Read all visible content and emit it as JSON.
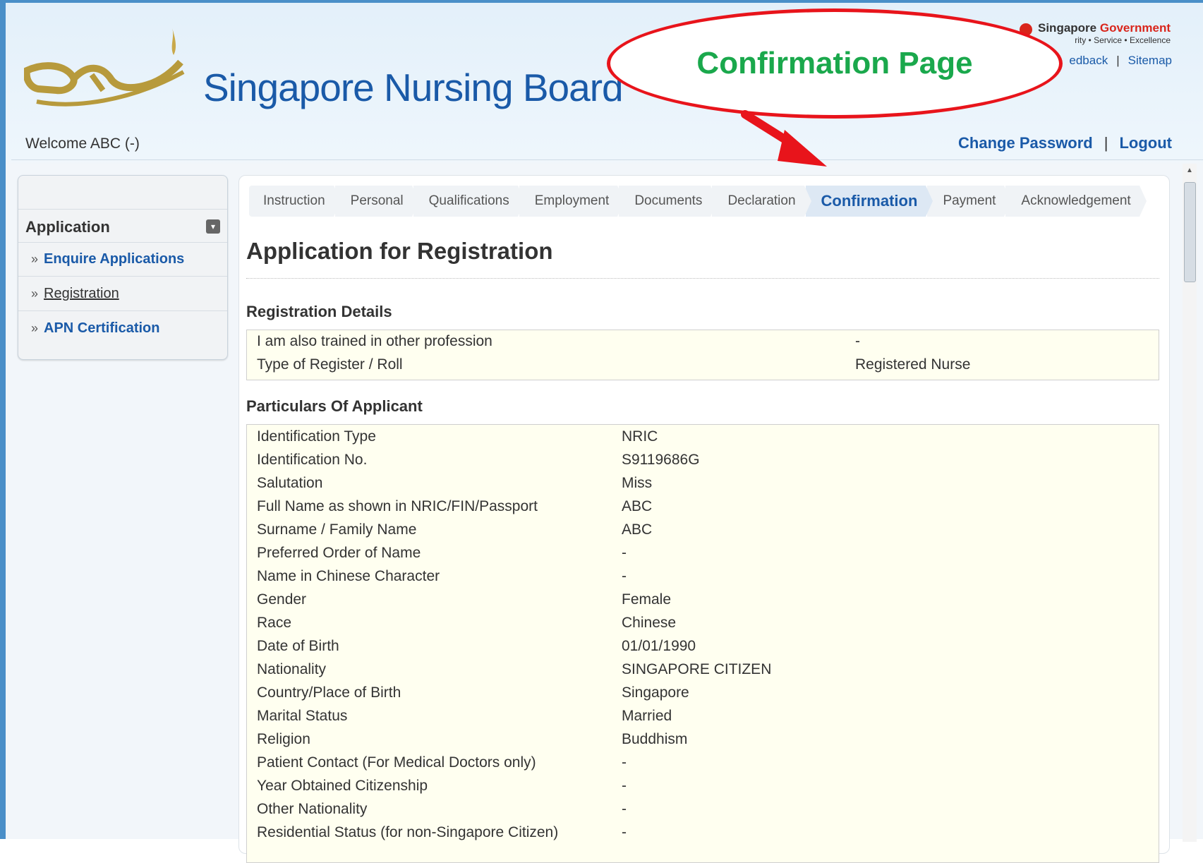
{
  "header": {
    "site_title": "Singapore Nursing Board",
    "gov_name_a": "Singapore",
    "gov_name_b": "Government",
    "gov_tagline": "rity • Service • Excellence",
    "toplinks": [
      "edback",
      "Sitemap"
    ],
    "welcome": "Welcome ABC (-)",
    "change_password": "Change Password",
    "logout": "Logout"
  },
  "annotation": {
    "callout": "Confirmation Page"
  },
  "sidebar": {
    "section": "Application",
    "items": [
      {
        "label": "Enquire Applications"
      },
      {
        "label": "Registration"
      },
      {
        "label": "APN Certification"
      }
    ],
    "bullet": "»"
  },
  "steps": [
    "Instruction",
    "Personal",
    "Qualifications",
    "Employment",
    "Documents",
    "Declaration",
    "Confirmation",
    "Payment",
    "Acknowledgement"
  ],
  "active_step": "Confirmation",
  "page_title": "Application for Registration",
  "registration_details": {
    "heading": "Registration Details",
    "rows": [
      {
        "label": "I am also trained in other profession",
        "value": "-"
      },
      {
        "label": "Type of Register / Roll",
        "value": "Registered Nurse"
      }
    ]
  },
  "particulars": {
    "heading": "Particulars Of Applicant",
    "rows": [
      {
        "label": "Identification Type",
        "value": "NRIC"
      },
      {
        "label": "Identification No.",
        "value": "S9119686G"
      },
      {
        "label": "Salutation",
        "value": "Miss"
      },
      {
        "label": "Full Name as shown in NRIC/FIN/Passport",
        "value": "ABC"
      },
      {
        "label": "Surname / Family Name",
        "value": "ABC"
      },
      {
        "label": "Preferred Order of Name",
        "value": "-"
      },
      {
        "label": "Name in Chinese Character",
        "value": "-"
      },
      {
        "label": "Gender",
        "value": "Female"
      },
      {
        "label": "Race",
        "value": "Chinese"
      },
      {
        "label": "Date of Birth",
        "value": "01/01/1990"
      },
      {
        "label": "Nationality",
        "value": "SINGAPORE CITIZEN"
      },
      {
        "label": "Country/Place of Birth",
        "value": "Singapore"
      },
      {
        "label": "Marital Status",
        "value": "Married"
      },
      {
        "label": "Religion",
        "value": "Buddhism"
      },
      {
        "label": "Patient Contact (For Medical Doctors only)",
        "value": "-"
      },
      {
        "label": "Year Obtained Citizenship",
        "value": "-"
      },
      {
        "label": "Other Nationality",
        "value": "-"
      },
      {
        "label": "Residential Status (for non-Singapore Citizen)",
        "value": "-"
      }
    ]
  },
  "colors": {
    "brand_blue": "#1a5aa8",
    "callout_red": "#e8141b",
    "callout_green": "#1aa84c",
    "gold": "#b79a3c"
  }
}
